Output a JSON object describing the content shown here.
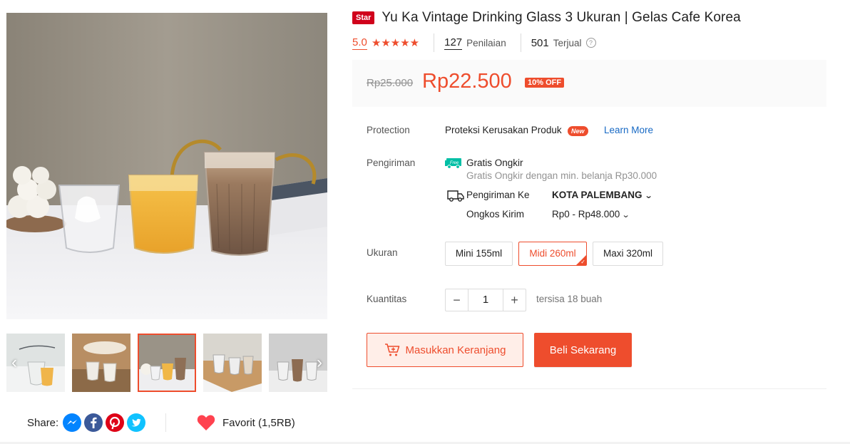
{
  "product": {
    "badge": "Star",
    "title": "Yu Ka Vintage Drinking Glass 3 Ukuran | Gelas Cafe Korea"
  },
  "stats": {
    "rating": "5.0",
    "stars": 5,
    "reviews_count": "127",
    "reviews_label": "Penilaian",
    "sold_count": "501",
    "sold_label": "Terjual"
  },
  "price": {
    "original": "Rp25.000",
    "current": "Rp22.500",
    "discount": "10% OFF"
  },
  "protection": {
    "label": "Protection",
    "value": "Proteksi Kerusakan Produk",
    "badge": "New",
    "link": "Learn More"
  },
  "shipping": {
    "label": "Pengiriman",
    "free_title": "Gratis Ongkir",
    "free_icon_text": "Free",
    "free_note": "Gratis Ongkir dengan min. belanja Rp30.000",
    "to_label": "Pengiriman Ke",
    "to_value": "KOTA PALEMBANG",
    "cost_label": "Ongkos Kirim",
    "cost_value": "Rp0 - Rp48.000"
  },
  "variants": {
    "label": "Ukuran",
    "options": [
      "Mini 155ml",
      "Midi 260ml",
      "Maxi 320ml"
    ],
    "selected_index": 1
  },
  "quantity": {
    "label": "Kuantitas",
    "value": "1",
    "minus": "−",
    "plus": "+",
    "stock_note": "tersisa 18 buah"
  },
  "actions": {
    "add_to_cart": "Masukkan Keranjang",
    "buy_now": "Beli Sekarang"
  },
  "gallery": {
    "thumb_count": 5,
    "active_index": 2,
    "prev_arrow": "‹",
    "next_arrow": "›"
  },
  "share": {
    "label": "Share:",
    "icons": [
      "messenger-icon",
      "facebook-icon",
      "pinterest-icon",
      "twitter-icon"
    ]
  },
  "favorite": {
    "label": "Favorit (1,5RB)"
  },
  "colors": {
    "accent": "#ee4d2d",
    "link": "#1769c4",
    "free_shipping": "#00bfa5"
  }
}
